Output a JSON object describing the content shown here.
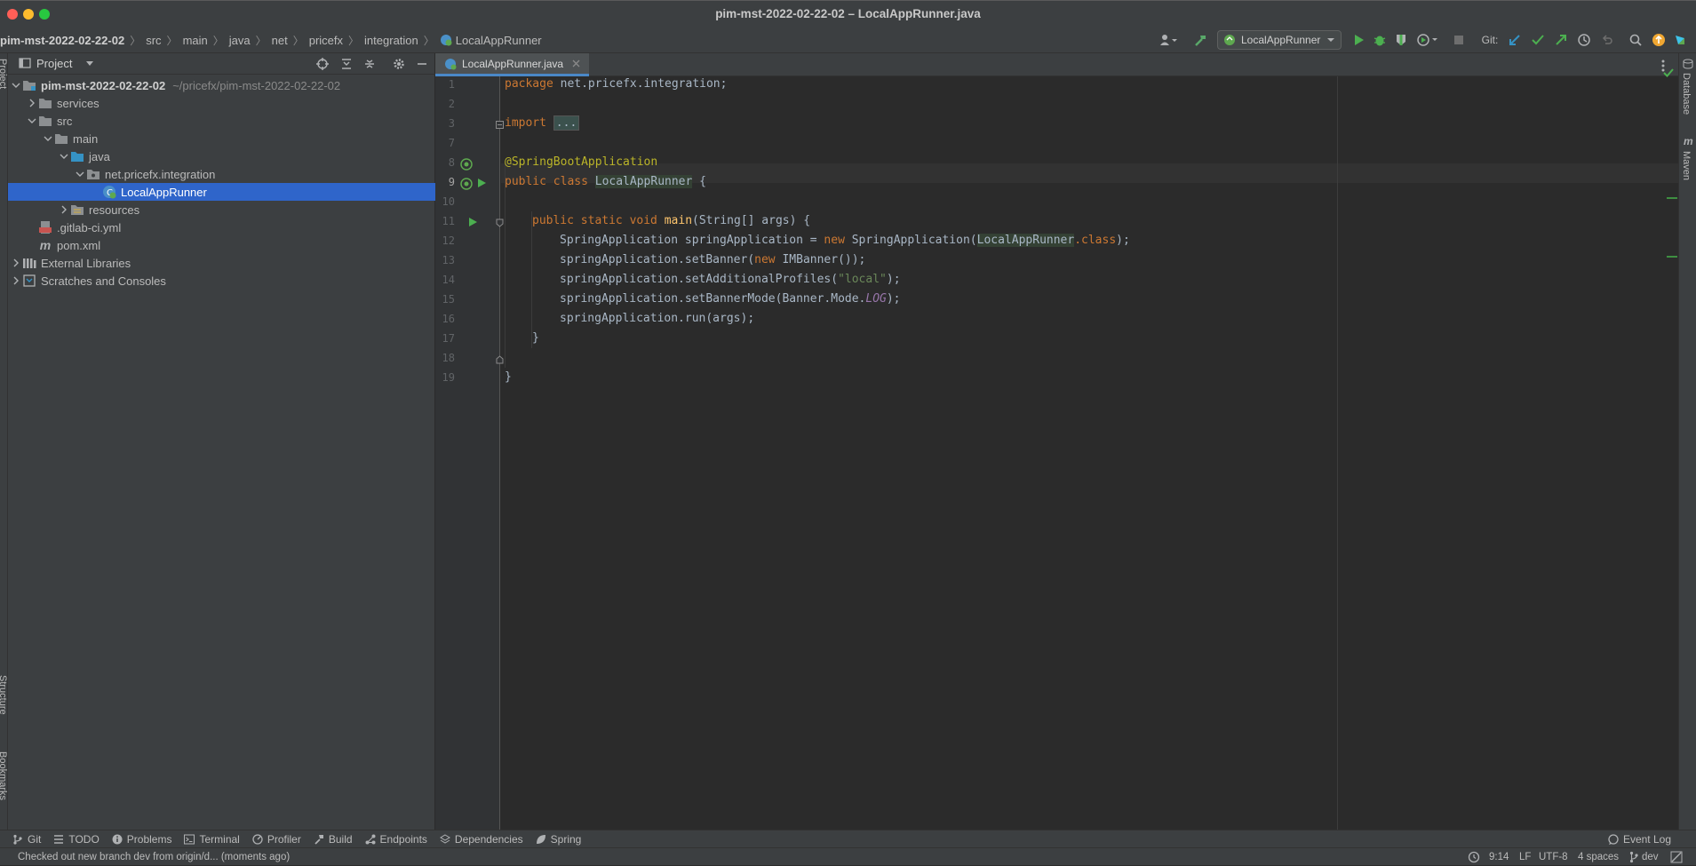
{
  "window": {
    "title": "pim-mst-2022-02-22-02 – LocalAppRunner.java"
  },
  "breadcrumb": [
    "pim-mst-2022-02-22-02",
    "src",
    "main",
    "java",
    "net",
    "pricefx",
    "integration",
    "LocalAppRunner"
  ],
  "toolbar": {
    "run_config": "LocalAppRunner",
    "git_label": "Git:"
  },
  "project_panel": {
    "title": "Project",
    "tree": [
      {
        "label": "pim-mst-2022-02-22-02",
        "hint": "~/pricefx/pim-mst-2022-02-22-02",
        "icon": "folder-icon"
      },
      {
        "label": "services",
        "icon": "folder-icon"
      },
      {
        "label": "src",
        "icon": "folder-icon"
      },
      {
        "label": "main",
        "icon": "folder-icon"
      },
      {
        "label": "java",
        "icon": "folder-icon"
      },
      {
        "label": "net.pricefx.integration",
        "icon": "package-icon"
      },
      {
        "label": "LocalAppRunner",
        "icon": "spring-class-icon"
      },
      {
        "label": "resources",
        "icon": "folder-icon"
      },
      {
        "label": ".gitlab-ci.yml",
        "icon": "yaml-file-icon"
      },
      {
        "label": "pom.xml",
        "icon": "maven-file-icon"
      },
      {
        "label": "External Libraries",
        "icon": "libraries-icon"
      },
      {
        "label": "Scratches and Consoles",
        "icon": "scratches-icon"
      }
    ]
  },
  "side_labels": {
    "left_top": "Project",
    "left_middle": "Structure",
    "left_bottom": "Bookmarks",
    "right_database": "Database",
    "right_maven": "Maven"
  },
  "editor": {
    "tab": "LocalAppRunner.java",
    "line_numbers": [
      "1",
      "2",
      "3",
      "7",
      "8",
      "9",
      "10",
      "11",
      "12",
      "13",
      "14",
      "15",
      "16",
      "17",
      "18",
      "19"
    ],
    "code": {
      "l1_kw": "package",
      "l1_rest": " net.pricefx.integration;",
      "l3_kw": "import",
      "l3_fold": "...",
      "l8": "@SpringBootApplication",
      "l9_kw": "public class",
      "l9_name": "LocalAppRunner",
      "l9_rest": " {",
      "l11_kw": "public static void",
      "l11_fn": "main",
      "l11_rest": "(String[] args) {",
      "l12_a": "SpringApplication springApplication = ",
      "l12_kw": "new",
      "l12_b": " SpringApplication(",
      "l12_name": "LocalAppRunner",
      "l12_kw2": ".class",
      "l12_c": ");",
      "l13_a": "springApplication.setBanner(",
      "l13_kw": "new",
      "l13_b": " IMBanner());",
      "l14_a": "springApplication.setAdditionalProfiles(",
      "l14_str": "\"local\"",
      "l14_b": ");",
      "l15_a": "springApplication.setBannerMode(Banner.Mode.",
      "l15_it": "LOG",
      "l15_b": ");",
      "l16": "springApplication.run(args);",
      "l17": "}",
      "l19": "}"
    }
  },
  "bottom_tools": [
    {
      "label": "Git",
      "icon": "git-branch-icon"
    },
    {
      "label": "TODO",
      "icon": "list-icon"
    },
    {
      "label": "Problems",
      "icon": "info-icon"
    },
    {
      "label": "Terminal",
      "icon": "terminal-icon"
    },
    {
      "label": "Profiler",
      "icon": "profiler-icon"
    },
    {
      "label": "Build",
      "icon": "hammer-icon"
    },
    {
      "label": "Endpoints",
      "icon": "endpoints-icon"
    },
    {
      "label": "Dependencies",
      "icon": "layers-icon"
    },
    {
      "label": "Spring",
      "icon": "spring-leaf-icon"
    }
  ],
  "event_log": "Event Log",
  "status": {
    "message": "Checked out new branch dev from origin/d... (moments ago)",
    "position": "9:14",
    "line_sep": "LF",
    "encoding": "UTF-8",
    "indent": "4 spaces",
    "branch": "dev"
  },
  "colors": {
    "accent": "#2f65ca",
    "background": "#2b2b2b",
    "panel": "#3c3f41",
    "run_green": "#4caf50"
  }
}
